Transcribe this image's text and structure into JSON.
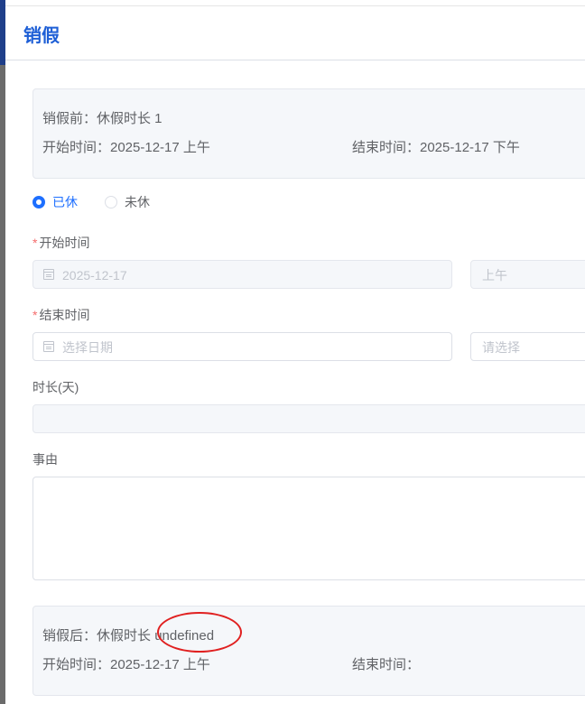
{
  "dialog": {
    "title": "销假"
  },
  "before": {
    "duration_line": "销假前：休假时长 1",
    "start_line": "开始时间：2025-12-17 上午",
    "end_line": "结束时间：2025-12-17 下午"
  },
  "status": {
    "options": [
      "已休",
      "未休"
    ],
    "selected": "已休"
  },
  "form": {
    "start_label": "开始时间",
    "start_date_value": "2025-12-17",
    "start_period_value": "上午",
    "end_label": "结束时间",
    "end_date_placeholder": "选择日期",
    "end_period_placeholder": "请选择",
    "duration_label": "时长(天)",
    "duration_value": "",
    "reason_label": "事由",
    "reason_value": "",
    "required_mark": "*"
  },
  "after": {
    "duration_prefix": "销假后：休假时长",
    "duration_value": "undefined",
    "start_line": "开始时间：2025-12-17 上午",
    "end_line": "结束时间："
  },
  "colors": {
    "title": "#1e5fd6",
    "radio_checked": "#1e6fff",
    "required": "#f56c6c",
    "annotation_circle": "#e02020"
  }
}
